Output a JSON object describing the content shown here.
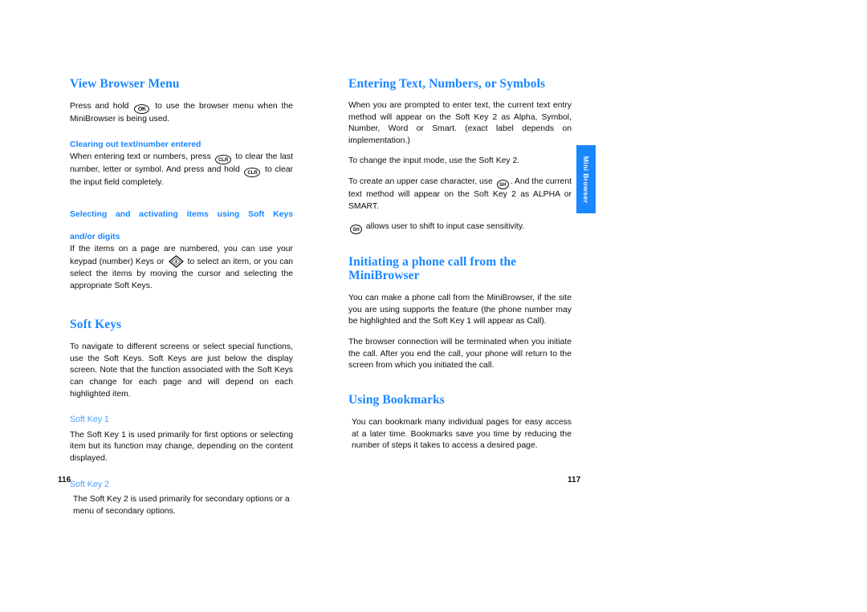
{
  "document": {
    "type": "user-manual-spread",
    "accent_color": "#1a87ff",
    "subheading_color": "#4aa3f7",
    "body_color": "#0d0d0d",
    "background": "#ffffff"
  },
  "side_tab": {
    "label": "Mini Browser",
    "background": "#1a87ff",
    "text_color": "#ffffff"
  },
  "left_page": {
    "folio": "116",
    "sections": [
      {
        "heading": "View Browser Menu",
        "paragraphs": [
          {
            "parts": [
              "Press and hold ",
              {
                "icon": "ok-key-icon",
                "label": "OK"
              },
              " to use the browser menu when the MiniBrowser is being used."
            ]
          }
        ]
      },
      {
        "subheading": "Clearing out text/number entered",
        "paragraphs": [
          {
            "parts": [
              "When entering text or numbers, press ",
              {
                "icon": "clr-key-icon",
                "label": "CLR"
              },
              " to clear the last number, letter or symbol. And press and hold ",
              {
                "icon": "clr-key-icon",
                "label": "CLR"
              },
              " to clear the input field completely."
            ]
          }
        ]
      },
      {
        "subheading_line1": "Selecting and activating items using Soft Keys",
        "subheading_line2": "and/or digits",
        "paragraphs": [
          {
            "parts": [
              "If the items on a page are numbered, you can use your keypad (number) Keys or ",
              {
                "icon": "navigation-key-icon",
                "label": "NAV"
              },
              " to select an item, or you can select the items by moving the cursor and selecting the appropriate Soft Keys."
            ]
          }
        ]
      },
      {
        "heading": "Soft Keys",
        "paragraphs": [
          {
            "text": "To navigate to different screens or select special functions, use the Soft Keys. Soft Keys are just below the display screen. Note that the function associated with the Soft Keys can change for each page and will depend on each highlighted item."
          }
        ],
        "key_blocks": [
          {
            "title": "Soft Key 1",
            "text": "The Soft Key 1 is used primarily for first options or selecting item but its function may change, depending on the content displayed."
          },
          {
            "title": "Soft Key 2",
            "text": "The Soft Key 2 is used primarily for secondary options or a menu of secondary options."
          }
        ]
      }
    ]
  },
  "right_page": {
    "folio": "117",
    "sections": [
      {
        "heading": "Entering Text, Numbers, or Symbols",
        "paragraphs": [
          {
            "text": "When you are prompted to enter text, the current text entry method will appear on the Soft Key 2 as Alpha, Symbol, Number, Word or Smart. (exact label depends on implementation.)"
          },
          {
            "text": "To change the input mode, use the Soft Key 2."
          },
          {
            "parts": [
              "To create an upper case character, use ",
              {
                "icon": "shift-key-icon",
                "label": "SH"
              },
              ". And the current text method will appear on the Soft Key 2 as ALPHA or SMART."
            ]
          },
          {
            "parts": [
              {
                "icon": "shift-key-icon",
                "label": "SH"
              },
              " allows user to shift to input case sensitivity."
            ]
          }
        ]
      },
      {
        "heading": "Initiating a phone call from the MiniBrowser",
        "paragraphs": [
          {
            "text": "You can make a phone call from the MiniBrowser, if the site you are using supports the feature (the phone number may be highlighted and the Soft Key 1 will appear as Call)."
          },
          {
            "text": "The browser connection will be terminated when you initiate the call. After you end the call, your phone will return to the screen from which you initiated the call."
          }
        ]
      },
      {
        "heading": "Using Bookmarks",
        "paragraphs": [
          {
            "text": "You can bookmark many individual pages for easy access at a later time. Bookmarks save you time by reducing the number of steps it takes to access a desired page."
          }
        ]
      }
    ]
  }
}
